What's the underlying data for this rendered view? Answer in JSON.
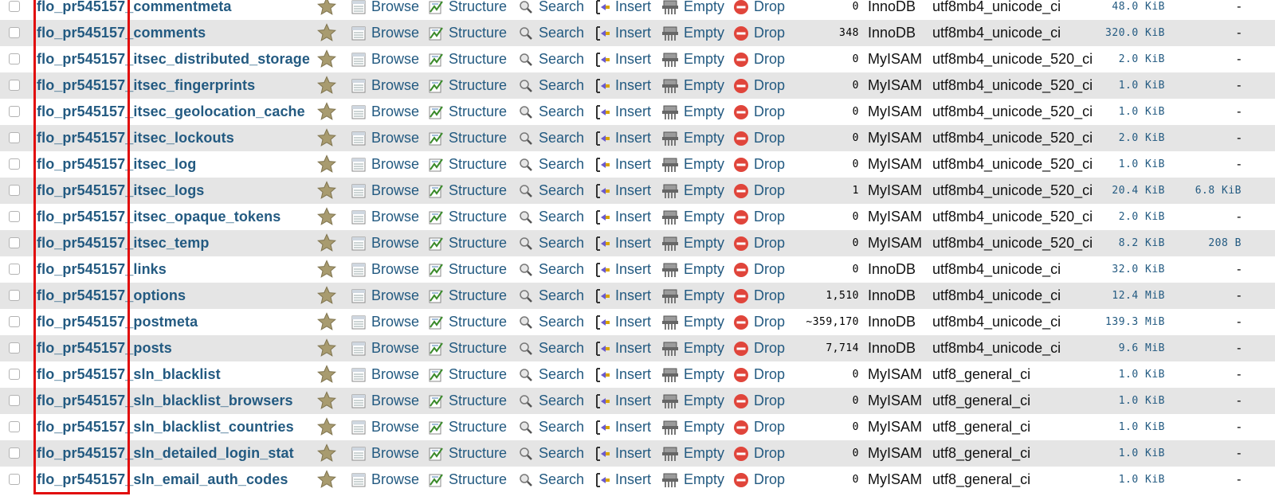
{
  "actions": {
    "browse": "Browse",
    "structure": "Structure",
    "search": "Search",
    "insert": "Insert",
    "empty": "Empty",
    "drop": "Drop"
  },
  "colors": {
    "link": "#235a81",
    "row_alt": "#e5e5e5",
    "highlight": "#e10c0c",
    "drop_icon": "#e0453b"
  },
  "icons": {
    "favorite": "star-icon",
    "browse": "browse-icon",
    "structure": "structure-icon",
    "search": "search-icon",
    "insert": "insert-icon",
    "empty": "empty-icon",
    "drop": "drop-icon"
  },
  "tables": [
    {
      "name": "flo_pr545157_commentmeta",
      "rows": "0",
      "engine": "InnoDB",
      "collation": "utf8mb4_unicode_ci",
      "size": "48.0 KiB",
      "overhead": "-"
    },
    {
      "name": "flo_pr545157_comments",
      "rows": "348",
      "engine": "InnoDB",
      "collation": "utf8mb4_unicode_ci",
      "size": "320.0 KiB",
      "overhead": "-"
    },
    {
      "name": "flo_pr545157_itsec_distributed_storage",
      "rows": "0",
      "engine": "MyISAM",
      "collation": "utf8mb4_unicode_520_ci",
      "size": "2.0 KiB",
      "overhead": "-"
    },
    {
      "name": "flo_pr545157_itsec_fingerprints",
      "rows": "0",
      "engine": "MyISAM",
      "collation": "utf8mb4_unicode_520_ci",
      "size": "1.0 KiB",
      "overhead": "-"
    },
    {
      "name": "flo_pr545157_itsec_geolocation_cache",
      "rows": "0",
      "engine": "MyISAM",
      "collation": "utf8mb4_unicode_520_ci",
      "size": "1.0 KiB",
      "overhead": "-"
    },
    {
      "name": "flo_pr545157_itsec_lockouts",
      "rows": "0",
      "engine": "MyISAM",
      "collation": "utf8mb4_unicode_520_ci",
      "size": "2.0 KiB",
      "overhead": "-"
    },
    {
      "name": "flo_pr545157_itsec_log",
      "rows": "0",
      "engine": "MyISAM",
      "collation": "utf8mb4_unicode_520_ci",
      "size": "1.0 KiB",
      "overhead": "-"
    },
    {
      "name": "flo_pr545157_itsec_logs",
      "rows": "1",
      "engine": "MyISAM",
      "collation": "utf8mb4_unicode_520_ci",
      "size": "20.4 KiB",
      "overhead": "6.8 KiB"
    },
    {
      "name": "flo_pr545157_itsec_opaque_tokens",
      "rows": "0",
      "engine": "MyISAM",
      "collation": "utf8mb4_unicode_520_ci",
      "size": "2.0 KiB",
      "overhead": "-"
    },
    {
      "name": "flo_pr545157_itsec_temp",
      "rows": "0",
      "engine": "MyISAM",
      "collation": "utf8mb4_unicode_520_ci",
      "size": "8.2 KiB",
      "overhead": "208 B"
    },
    {
      "name": "flo_pr545157_links",
      "rows": "0",
      "engine": "InnoDB",
      "collation": "utf8mb4_unicode_ci",
      "size": "32.0 KiB",
      "overhead": "-"
    },
    {
      "name": "flo_pr545157_options",
      "rows": "1,510",
      "engine": "InnoDB",
      "collation": "utf8mb4_unicode_ci",
      "size": "12.4 MiB",
      "overhead": "-"
    },
    {
      "name": "flo_pr545157_postmeta",
      "rows": "~359,170",
      "engine": "InnoDB",
      "collation": "utf8mb4_unicode_ci",
      "size": "139.3 MiB",
      "overhead": "-"
    },
    {
      "name": "flo_pr545157_posts",
      "rows": "7,714",
      "engine": "InnoDB",
      "collation": "utf8mb4_unicode_ci",
      "size": "9.6 MiB",
      "overhead": "-"
    },
    {
      "name": "flo_pr545157_sln_blacklist",
      "rows": "0",
      "engine": "MyISAM",
      "collation": "utf8_general_ci",
      "size": "1.0 KiB",
      "overhead": "-"
    },
    {
      "name": "flo_pr545157_sln_blacklist_browsers",
      "rows": "0",
      "engine": "MyISAM",
      "collation": "utf8_general_ci",
      "size": "1.0 KiB",
      "overhead": "-"
    },
    {
      "name": "flo_pr545157_sln_blacklist_countries",
      "rows": "0",
      "engine": "MyISAM",
      "collation": "utf8_general_ci",
      "size": "1.0 KiB",
      "overhead": "-"
    },
    {
      "name": "flo_pr545157_sln_detailed_login_stat",
      "rows": "0",
      "engine": "MyISAM",
      "collation": "utf8_general_ci",
      "size": "1.0 KiB",
      "overhead": "-"
    },
    {
      "name": "flo_pr545157_sln_email_auth_codes",
      "rows": "0",
      "engine": "MyISAM",
      "collation": "utf8_general_ci",
      "size": "1.0 KiB",
      "overhead": "-"
    }
  ]
}
